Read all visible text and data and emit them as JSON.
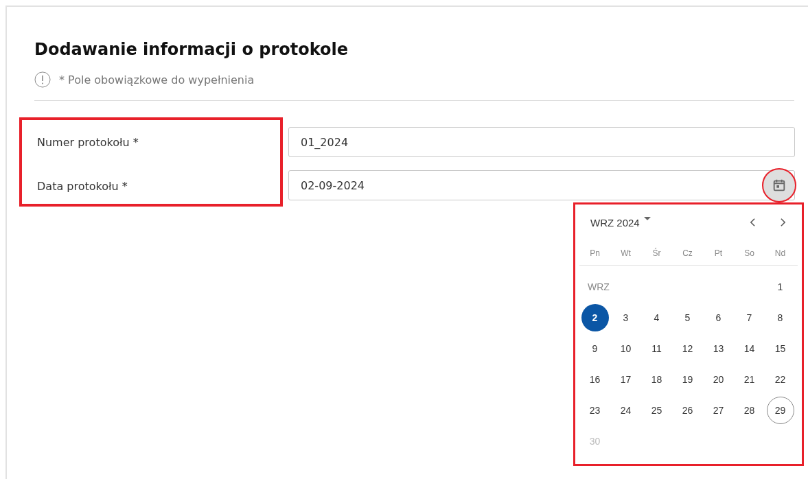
{
  "title": "Dodawanie informacji o protokole",
  "required_note": "* Pole obowiązkowe do wypełnienia",
  "form": {
    "highlighted": true,
    "fields": [
      {
        "kind": "text",
        "label": "Numer protokołu *",
        "value": "01_2024"
      },
      {
        "kind": "date",
        "label": "Data protokołu  *",
        "value": "02-09-2024",
        "picker_highlighted": true
      }
    ]
  },
  "calendar": {
    "highlighted": true,
    "header": "WRZ 2024",
    "weekdays": [
      "Pn",
      "Wt",
      "Śr",
      "Cz",
      "Pt",
      "So",
      "Nd"
    ],
    "month_label": "WRZ",
    "days": [
      {
        "label": "1",
        "selected": false,
        "today": false,
        "disabled": false
      },
      {
        "label": "2",
        "selected": true,
        "today": false,
        "disabled": false
      },
      {
        "label": "3",
        "selected": false,
        "today": false,
        "disabled": false
      },
      {
        "label": "4",
        "selected": false,
        "today": false,
        "disabled": false
      },
      {
        "label": "5",
        "selected": false,
        "today": false,
        "disabled": false
      },
      {
        "label": "6",
        "selected": false,
        "today": false,
        "disabled": false
      },
      {
        "label": "7",
        "selected": false,
        "today": false,
        "disabled": false
      },
      {
        "label": "8",
        "selected": false,
        "today": false,
        "disabled": false
      },
      {
        "label": "9",
        "selected": false,
        "today": false,
        "disabled": false
      },
      {
        "label": "10",
        "selected": false,
        "today": false,
        "disabled": false
      },
      {
        "label": "11",
        "selected": false,
        "today": false,
        "disabled": false
      },
      {
        "label": "12",
        "selected": false,
        "today": false,
        "disabled": false
      },
      {
        "label": "13",
        "selected": false,
        "today": false,
        "disabled": false
      },
      {
        "label": "14",
        "selected": false,
        "today": false,
        "disabled": false
      },
      {
        "label": "15",
        "selected": false,
        "today": false,
        "disabled": false
      },
      {
        "label": "16",
        "selected": false,
        "today": false,
        "disabled": false
      },
      {
        "label": "17",
        "selected": false,
        "today": false,
        "disabled": false
      },
      {
        "label": "18",
        "selected": false,
        "today": false,
        "disabled": false
      },
      {
        "label": "19",
        "selected": false,
        "today": false,
        "disabled": false
      },
      {
        "label": "20",
        "selected": false,
        "today": false,
        "disabled": false
      },
      {
        "label": "21",
        "selected": false,
        "today": false,
        "disabled": false
      },
      {
        "label": "22",
        "selected": false,
        "today": false,
        "disabled": false
      },
      {
        "label": "23",
        "selected": false,
        "today": false,
        "disabled": false
      },
      {
        "label": "24",
        "selected": false,
        "today": false,
        "disabled": false
      },
      {
        "label": "25",
        "selected": false,
        "today": false,
        "disabled": false
      },
      {
        "label": "26",
        "selected": false,
        "today": false,
        "disabled": false
      },
      {
        "label": "27",
        "selected": false,
        "today": false,
        "disabled": false
      },
      {
        "label": "28",
        "selected": false,
        "today": false,
        "disabled": false
      },
      {
        "label": "29",
        "selected": false,
        "today": true,
        "disabled": false
      },
      {
        "label": "30",
        "selected": false,
        "today": false,
        "disabled": true
      }
    ]
  }
}
